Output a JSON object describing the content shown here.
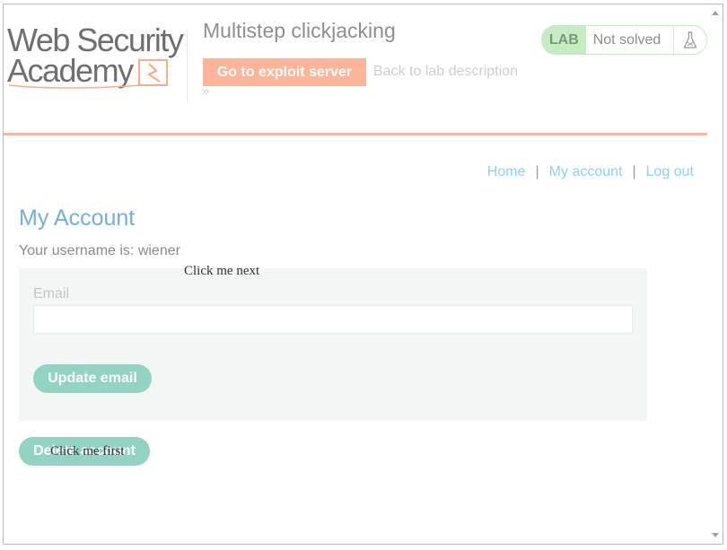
{
  "header": {
    "logo_line1": "Web Security",
    "logo_line2": "Academy",
    "lab_title": "Multistep clickjacking",
    "exploit_button": "Go to exploit server",
    "back_link": "Back to lab description",
    "back_chevron": "»",
    "lab_badge": "LAB",
    "lab_status": "Not solved",
    "accent_color": "#fcb59b"
  },
  "nav": {
    "home": "Home",
    "separator": "|",
    "my_account": "My account",
    "log_out": "Log out"
  },
  "account": {
    "title": "My Account",
    "username_text": "Your username is: wiener",
    "email_label": "Email",
    "email_value": "",
    "update_button": "Update email",
    "delete_button": "Delete account"
  },
  "decoys": {
    "next": "Click me next",
    "first": "Click me first"
  },
  "icons": {
    "flask": "flask-icon",
    "logo_mark": "lightning-icon"
  }
}
